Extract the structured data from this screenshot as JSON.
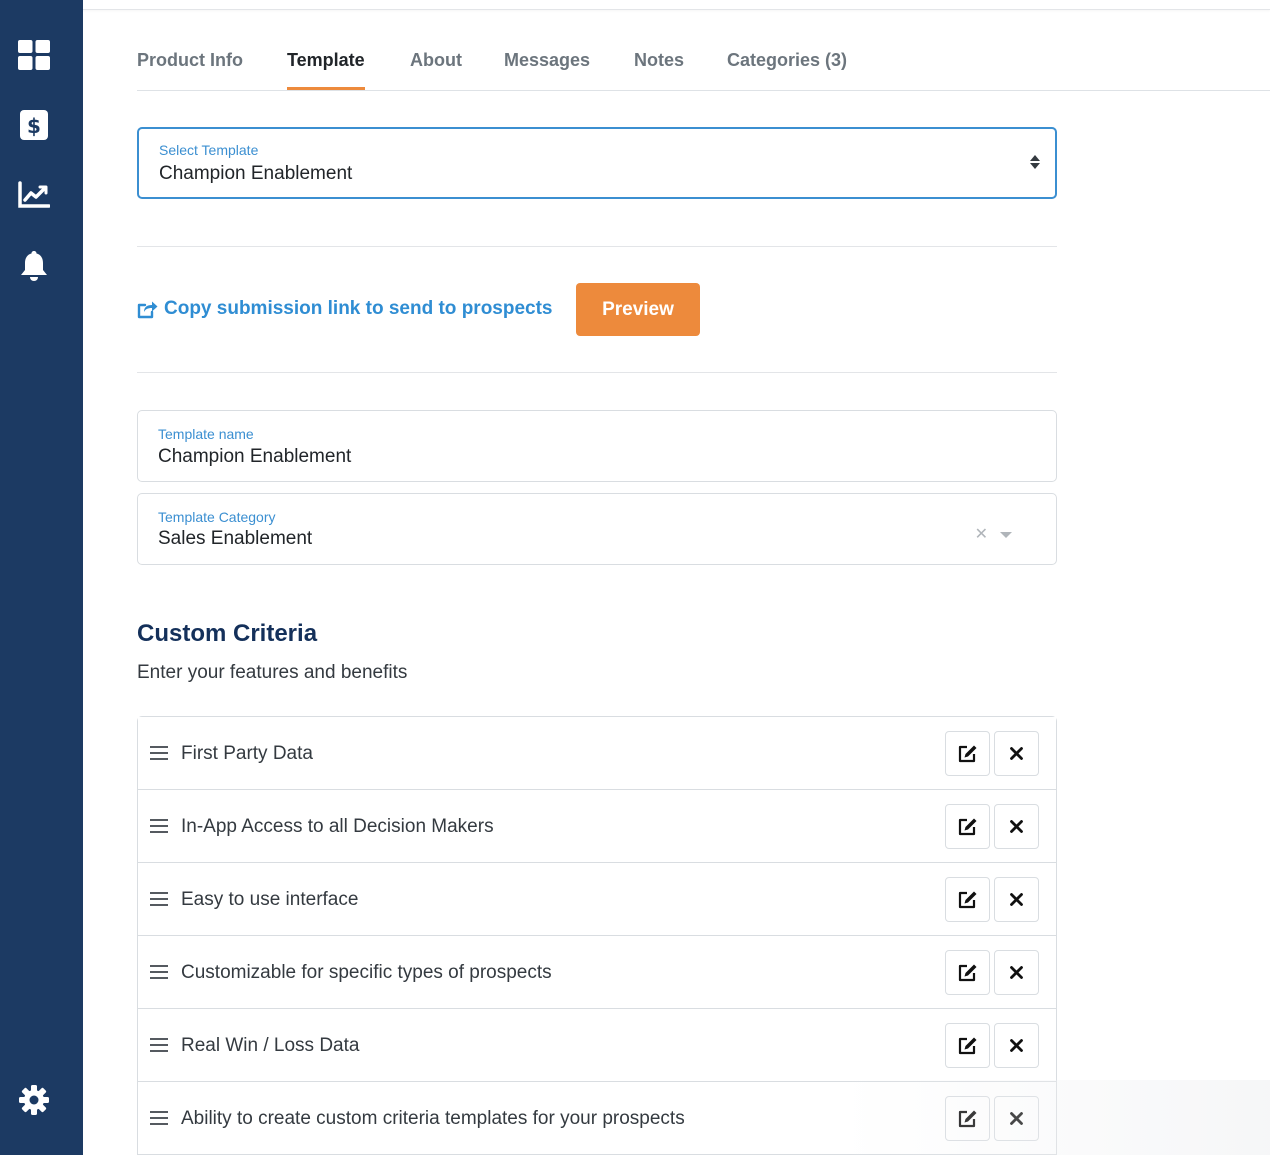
{
  "sidebar": {
    "items": [
      {
        "icon": "dashboard-grid-icon"
      },
      {
        "icon": "dollar-icon"
      },
      {
        "icon": "chart-line-icon"
      },
      {
        "icon": "bell-icon"
      }
    ],
    "settings_icon": "gear-icon",
    "background": "#1c3a63"
  },
  "tabs": [
    {
      "label": "Product Info",
      "active": false
    },
    {
      "label": "Template",
      "active": true
    },
    {
      "label": "About",
      "active": false
    },
    {
      "label": "Messages",
      "active": false
    },
    {
      "label": "Notes",
      "active": false
    },
    {
      "label": "Categories (3)",
      "active": false
    }
  ],
  "select_template": {
    "label": "Select Template",
    "value": "Champion Enablement"
  },
  "copy_link": {
    "label": "Copy submission link to send to prospects",
    "icon": "share-external-icon"
  },
  "preview_button": {
    "label": "Preview"
  },
  "template_name": {
    "label": "Template name",
    "value": "Champion Enablement"
  },
  "template_category": {
    "label": "Template Category",
    "value": "Sales Enablement"
  },
  "custom_criteria": {
    "title": "Custom Criteria",
    "subtitle": "Enter your features and benefits",
    "items": [
      "First Party Data",
      "In-App Access to all Decision Makers",
      "Easy to use interface",
      "Customizable for specific types of prospects",
      "Real Win / Loss Data",
      "Ability to create custom criteria templates for your prospects"
    ]
  },
  "colors": {
    "accent_orange": "#ed8a3c",
    "link_blue": "#2f8dd3",
    "heading_navy": "#14305a"
  }
}
